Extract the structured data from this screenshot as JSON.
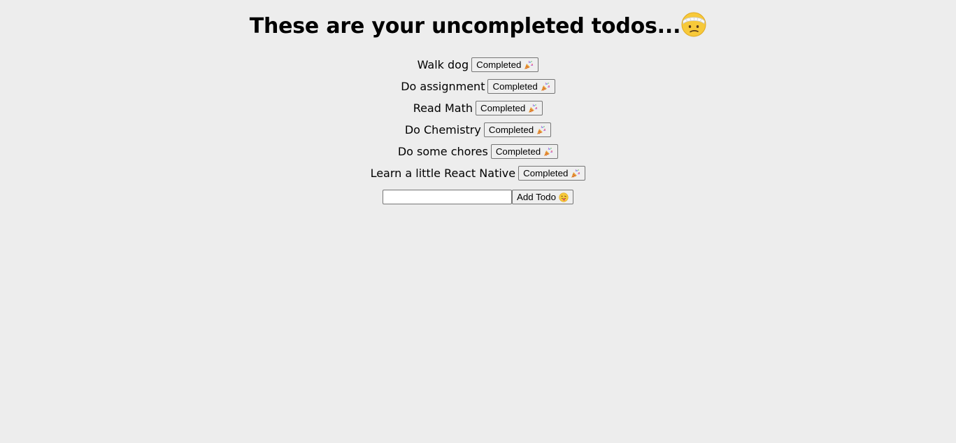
{
  "header": {
    "title": "These are your uncompleted todos...",
    "emoji_icon": "head-bandage-face-icon"
  },
  "todos": [
    {
      "text": "Walk dog",
      "button_label": "Completed"
    },
    {
      "text": "Do assignment",
      "button_label": "Completed"
    },
    {
      "text": "Read Math",
      "button_label": "Completed"
    },
    {
      "text": "Do Chemistry",
      "button_label": "Completed"
    },
    {
      "text": "Do some chores",
      "button_label": "Completed"
    },
    {
      "text": "Learn a little React Native",
      "button_label": "Completed"
    }
  ],
  "completed_button_icon": "party-popper-icon",
  "add_form": {
    "input_value": "",
    "input_placeholder": "",
    "button_label": "Add Todo",
    "button_icon": "tongue-face-icon"
  },
  "colors": {
    "background": "#ededed",
    "button_bg": "#efefef",
    "button_border": "#767676"
  }
}
